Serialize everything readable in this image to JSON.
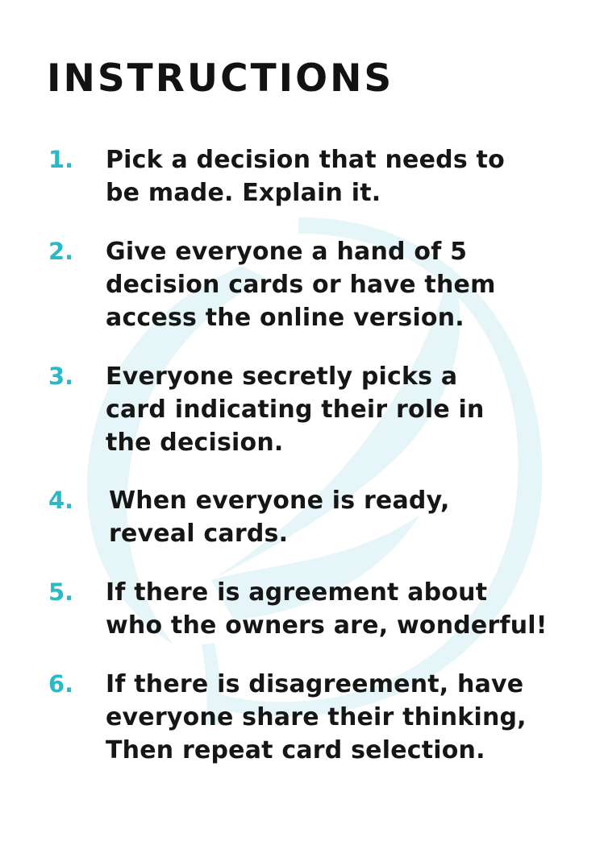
{
  "title": "INSTRUCTIONS",
  "colors": {
    "accent": "#2cb8c4",
    "text": "#161616",
    "watermark": "#e6f5f7"
  },
  "watermark_icon": "leaf-swirl-logo",
  "steps": [
    {
      "number": "1.",
      "text": "Pick a decision that needs to\nbe made. Explain it."
    },
    {
      "number": "2.",
      "text": "Give everyone a hand of 5\ndecision cards or have them\naccess the online version."
    },
    {
      "number": "3.",
      "text": "Everyone secretly picks a\ncard indicating their role in\nthe decision."
    },
    {
      "number": "4.",
      "text": "When everyone is ready,\nreveal cards."
    },
    {
      "number": "5.",
      "text": "If there is agreement about\nwho the owners are, wonderful!"
    },
    {
      "number": "6.",
      "text": "If there is disagreement, have\neveryone share their thinking,\nThen repeat card selection."
    }
  ]
}
